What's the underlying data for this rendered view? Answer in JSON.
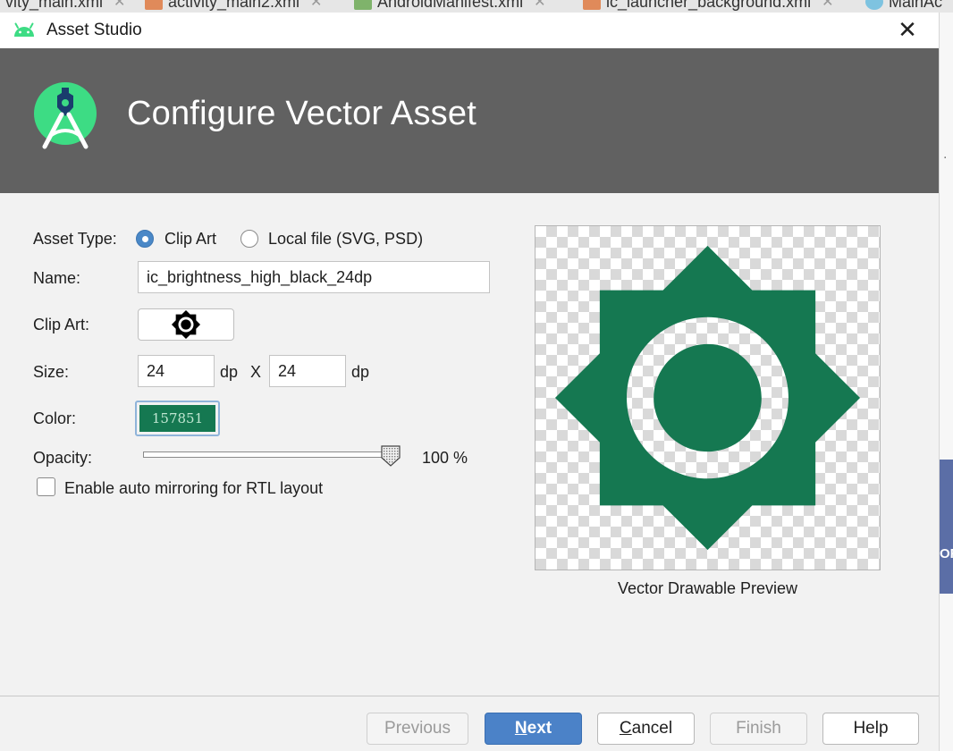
{
  "ide_tabs": [
    {
      "label": "vity_main.xml"
    },
    {
      "label": "activity_main2.xml"
    },
    {
      "label": "AndroidManifest.xml"
    },
    {
      "label": "ic_launcher_background.xml"
    },
    {
      "label": "MainAc"
    }
  ],
  "window": {
    "title": "Asset Studio",
    "close_glyph": "✕"
  },
  "banner": {
    "heading": "Configure Vector Asset"
  },
  "form": {
    "asset_type_label": "Asset Type:",
    "asset_type_options": [
      "Clip Art",
      "Local file (SVG, PSD)"
    ],
    "asset_type_selected": "Clip Art",
    "name_label": "Name:",
    "name_value": "ic_brightness_high_black_24dp",
    "clip_art_label": "Clip Art:",
    "clip_art_icon": "brightness-high-icon",
    "size_label": "Size:",
    "size_width": "24",
    "size_unit": "dp",
    "size_separator": "X",
    "size_height": "24",
    "color_label": "Color:",
    "color_value": "157851",
    "color_hex": "#157851",
    "opacity_label": "Opacity:",
    "opacity_value": 100,
    "opacity_text": "100 %",
    "rtl_checkbox_label": "Enable auto mirroring for RTL layout",
    "rtl_checked": false
  },
  "preview": {
    "caption": "Vector Drawable Preview",
    "icon": "brightness-high-icon",
    "icon_color": "#157851"
  },
  "buttons": {
    "previous": {
      "label": "Previous",
      "enabled": false
    },
    "next": {
      "label": "Next",
      "mnemonic": "N",
      "rest": "ext",
      "enabled": true
    },
    "cancel": {
      "label": "Cancel",
      "mnemonic": "C",
      "rest": "ancel",
      "enabled": true
    },
    "finish": {
      "label": "Finish",
      "enabled": false
    },
    "help": {
      "label": "Help",
      "enabled": true
    }
  },
  "background_strip": {
    "edge_text": "OR"
  }
}
